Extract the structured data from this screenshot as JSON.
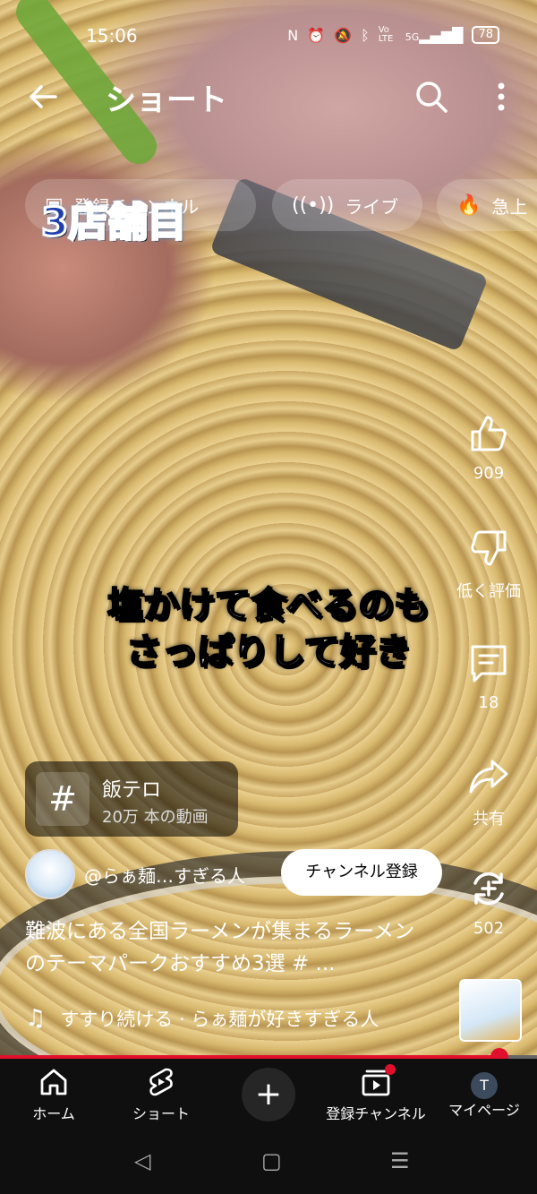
{
  "status": {
    "time": "15:06",
    "icons": [
      "nfc-icon",
      "alarm-icon",
      "mute-icon",
      "bluetooth-icon",
      "volte-icon",
      "5g-signal-icon"
    ],
    "volte": "Vo LTE",
    "network": "5G",
    "battery": "78"
  },
  "appbar": {
    "title": "ショート"
  },
  "chips": [
    {
      "label": "登録チャンネル",
      "icon": "subscriptions-icon"
    },
    {
      "label": "ライブ",
      "icon": "live-icon"
    },
    {
      "label": "急上",
      "icon": "trending-icon"
    }
  ],
  "overlay": {
    "logo_text": "3店舗目",
    "caption_line1": "塩かけて食べるのも",
    "caption_line2": "さっぱりして好き"
  },
  "actions": {
    "like_count": "909",
    "dislike_label": "低く評価",
    "comment_count": "18",
    "share_label": "共有",
    "remix_count": "502"
  },
  "hashtag": {
    "symbol": "#",
    "title": "飯テロ",
    "count": "20万 本の動画"
  },
  "channel": {
    "name": "@らぁ麺…すぎる人",
    "subscribe_label": "チャンネル登録"
  },
  "description": "難波にある全国ラーメンが集まるラーメンのテーマパークおすすめ3選 # ...",
  "music": {
    "text": "すすり続ける · らぁ麺が好きすぎる人"
  },
  "progress": {
    "value": 0.93
  },
  "nav": {
    "home": "ホーム",
    "shorts": "ショート",
    "create": "+",
    "subscriptions": "登録チャンネル",
    "mypage": "マイページ",
    "avatar_letter": "T"
  },
  "colors": {
    "accent": "#e0102c",
    "nav_bg": "#0f0f0f"
  }
}
